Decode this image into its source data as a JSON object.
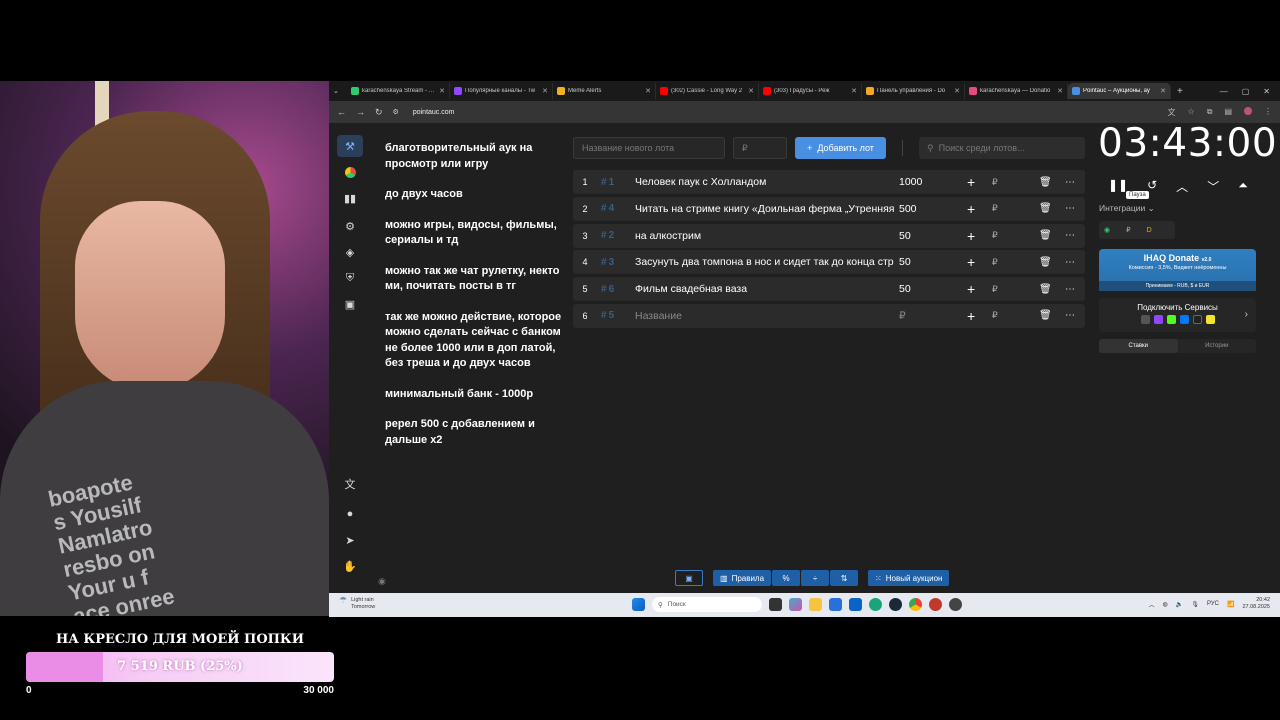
{
  "overlay": {
    "goal_title": "НА КРЕСЛО ДЛЯ МОЕЙ ПОПКИ",
    "goal_amount": "7 519 RUB (25%)",
    "goal_progress": 0.25,
    "goal_min": "0",
    "goal_max": "30 000",
    "shirt_text": "boapote\ns Yousilf\nNamlatro\nresbo on\nYour u f\nace onree"
  },
  "browser": {
    "tabs": [
      {
        "label": "karachenskaya Stream - Tw",
        "color": "#2ecc71"
      },
      {
        "label": "Популярные каналы - Tw",
        "color": "#9146ff"
      },
      {
        "label": "Meme Alerts",
        "color": "#f2b01e"
      },
      {
        "label": "(302) Cassie - Long Way 2",
        "color": "#ff0000"
      },
      {
        "label": "(303) Градусы - Реж",
        "color": "#ff0000"
      },
      {
        "label": "Панель управления - Do",
        "color": "#f5a623"
      },
      {
        "label": "karachenskaya — Donatio",
        "color": "#e84a7f"
      },
      {
        "label": "Pointauc – Аукционы, ау",
        "color": "#4a90e2",
        "active": true
      }
    ],
    "url": "pointauc.com"
  },
  "rules": [
    "благотворительный аук на просмотр или игру",
    "до  двух часов",
    "можно игры, видосы, фильмы, сериалы и тд",
    "можно так же чат рулетку, некто ми, почитать посты в тг",
    "так же можно действие, которое можно сделать сейчас с банком не более 1000 или в доп латой, без треша  и до двух часов",
    "минимальный банк - 1000р",
    "ререл 500 с добавлением и дальше х2"
  ],
  "controls": {
    "lot_placeholder": "Название нового лота",
    "price_placeholder": "₽",
    "add_lot_label": "Добавить лот",
    "search_placeholder": "Поиск среди лотов..."
  },
  "lots": [
    {
      "index": "1",
      "id": "1",
      "name": "Человек паук с Холландом",
      "amount": "1000"
    },
    {
      "index": "2",
      "id": "4",
      "name": "Читать на стриме книгу «Доильная ферма „Утренняя",
      "amount": "500"
    },
    {
      "index": "3",
      "id": "2",
      "name": "на алкострим",
      "amount": "50"
    },
    {
      "index": "4",
      "id": "3",
      "name": "Засунуть два томпона в нос и сидет так до конца стр",
      "amount": "50"
    },
    {
      "index": "5",
      "id": "6",
      "name": "Фильм свадебная ваза",
      "amount": "50"
    },
    {
      "index": "6",
      "id": "5",
      "name": "Название",
      "amount": "₽",
      "placeholder": true
    }
  ],
  "timer": {
    "value": "03:43:00",
    "pause_tooltip": "Пауза",
    "info_label": "Интеграции"
  },
  "donate_card": {
    "title": "IHAQ Donate",
    "version": "v2.0",
    "subtitle": "Комиссия - 3,5%, Виджет неёроменны",
    "payments": "Принимаем - RUB, $ и EUR"
  },
  "connect": {
    "title": "Подключить Сервисы"
  },
  "right_tabs": {
    "bets": "Ставки",
    "history": "Истории"
  },
  "bottom": {
    "rules_label": "Правила",
    "new_auction_label": "Новый аукцион"
  },
  "taskbar": {
    "weather_line1": "Light rain",
    "weather_line2": "Tomorrow",
    "search_placeholder": "Поиск",
    "lang": "РУС",
    "time": "20:42",
    "date": "27.08.2025"
  },
  "colors": {
    "accent": "#4a90e2",
    "background": "#1f1f1f",
    "row": "#2b2b2b"
  }
}
